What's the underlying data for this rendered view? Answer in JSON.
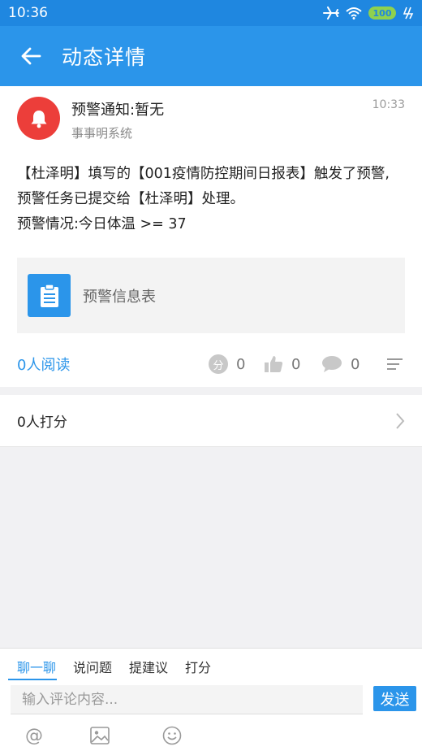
{
  "status_bar": {
    "time": "10:36",
    "battery": "100"
  },
  "header": {
    "title": "动态详情"
  },
  "post": {
    "title": "预警通知:暂无",
    "source": "事事明系统",
    "time": "10:33",
    "body_lines": [
      "【杜泽明】填写的【001疫情防控期间日报表】触发了预警,",
      "预警任务已提交给【杜泽明】处理。",
      "预警情况:今日体温 >= 37"
    ],
    "attachment_label": "预警信息表"
  },
  "stats": {
    "read_count": "0人阅读",
    "score_badge": "分",
    "score_value": "0",
    "like_value": "0",
    "comment_value": "0"
  },
  "rating": {
    "label": "0人打分"
  },
  "comment_bar": {
    "tabs": [
      "聊一聊",
      "说问题",
      "提建议",
      "打分"
    ],
    "active_tab": "聊一聊",
    "input_placeholder": "输入评论内容...",
    "send_label": "发送",
    "at_symbol": "@"
  },
  "colors": {
    "primary": "#2b95ea",
    "status_bar": "#1f87e0",
    "avatar_red": "#ec3e3a"
  },
  "icons": [
    "back-arrow-icon",
    "bell-icon",
    "clipboard-icon",
    "thumb-up-icon",
    "comment-bubble-icon",
    "menu-lines-icon",
    "chevron-right-icon",
    "at-icon",
    "image-icon",
    "emoji-icon",
    "airplane-icon",
    "wifi-icon",
    "battery-icon",
    "charging-icon"
  ]
}
